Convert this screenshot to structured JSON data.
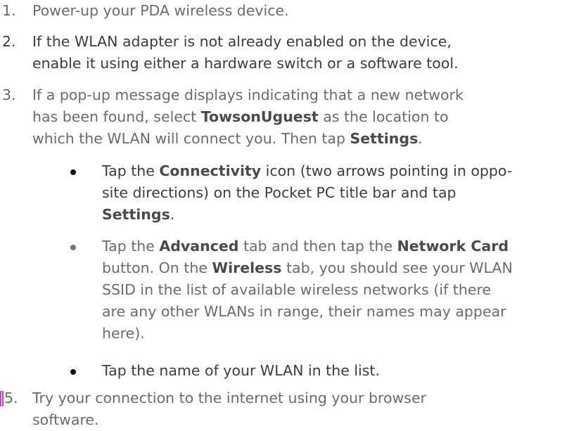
{
  "steps": [
    {
      "number": "1.",
      "text": "Power-up your PDA wireless device."
    },
    {
      "number": "2.",
      "line1": "If the WLAN adapter is not already enabled on the device,",
      "line2": "enable it using either a hardware switch or a software tool."
    },
    {
      "number": "3.",
      "line1": "If a pop-up message displays indicating that a new network",
      "line2_a": "has been found, select ",
      "line2_b": "TowsonUguest",
      "line2_c": " as the location to",
      "line3_a": "which the WLAN will connect you. Then tap ",
      "line3_b": "Settings",
      "line3_c": "."
    },
    {
      "number": "5.",
      "line1": "Try your connection to the internet using your browser",
      "line2": "software."
    }
  ],
  "bullets": [
    {
      "line1_a": "Tap the ",
      "line1_b": "Connectivity",
      "line1_c": " icon (two arrows pointing in oppo-",
      "line2": "site directions) on the Pocket PC title bar and tap",
      "line3_b": "Settings",
      "line3_c": "."
    },
    {
      "line1_a": "Tap the ",
      "line1_b": "Advanced",
      "line1_c": " tab and then tap the ",
      "line1_d": "Network Card",
      "line2_a": "button. On the ",
      "line2_b": "Wireless",
      "line2_c": " tab, you should see your WLAN",
      "line3": "SSID in the list of available wireless networks (if there",
      "line4": "are any other WLANs in range, their names may appear",
      "line5": "here)."
    },
    {
      "line1": "Tap the name of your WLAN in the list."
    }
  ]
}
